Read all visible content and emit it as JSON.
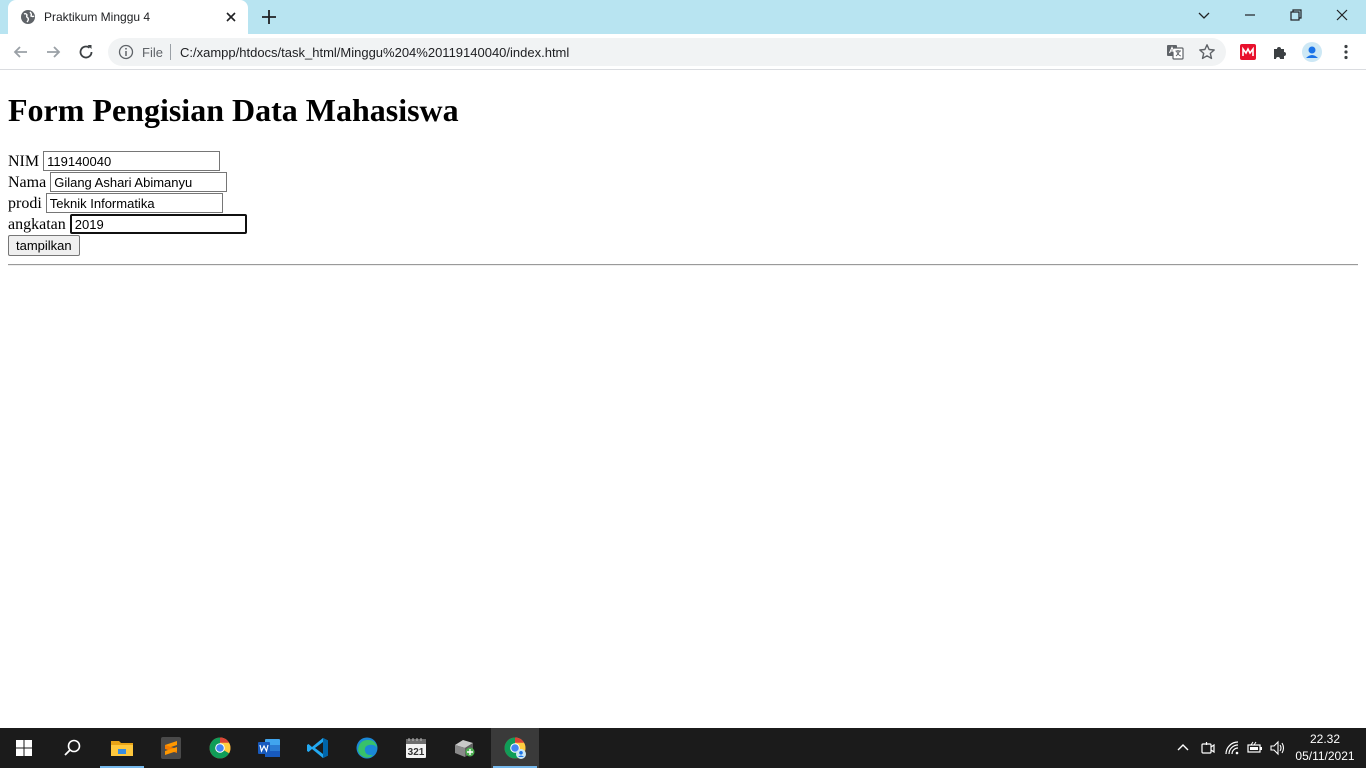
{
  "browser": {
    "tab_title": "Praktikum Minggu 4",
    "omnibox": {
      "scheme_label": "File",
      "url": "C:/xampp/htdocs/task_html/Minggu%204%20119140040/index.html"
    }
  },
  "page": {
    "heading": "Form Pengisian Data Mahasiswa",
    "fields": [
      {
        "label": "NIM",
        "value": "119140040"
      },
      {
        "label": "Nama",
        "value": "Gilang Ashari Abimanyu"
      },
      {
        "label": "prodi",
        "value": "Teknik Informatika"
      },
      {
        "label": "angkatan",
        "value": "2019"
      }
    ],
    "submit_label": "tampilkan"
  },
  "taskbar": {
    "apps": [
      "start-icon",
      "search-icon",
      "file-explorer-icon",
      "sublime-text-icon",
      "chrome-icon",
      "word-icon",
      "vscode-icon",
      "edge-icon",
      "calendar-app-icon",
      "xampp-icon",
      "chrome-profile-icon"
    ],
    "active_app": "chrome-profile-icon",
    "clock_time": "22.32",
    "clock_date": "05/11/2021"
  },
  "colors": {
    "tabstrip_bg": "#b8e4f1",
    "taskbar_bg": "#1b1b1b",
    "accent": "#76b9ed"
  }
}
